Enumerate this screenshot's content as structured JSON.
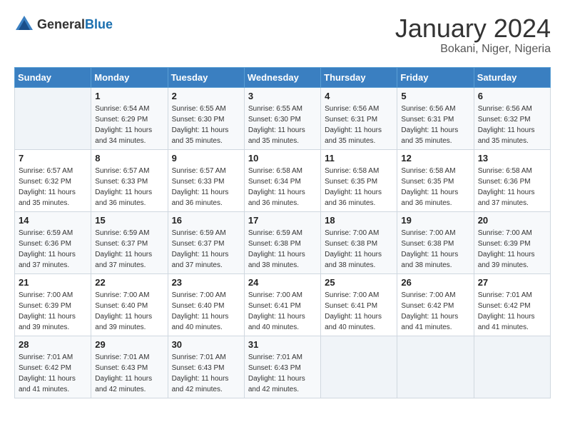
{
  "logo": {
    "general": "General",
    "blue": "Blue"
  },
  "header": {
    "title": "January 2024",
    "subtitle": "Bokani, Niger, Nigeria"
  },
  "weekdays": [
    "Sunday",
    "Monday",
    "Tuesday",
    "Wednesday",
    "Thursday",
    "Friday",
    "Saturday"
  ],
  "weeks": [
    [
      {
        "day": "",
        "sunrise": "",
        "sunset": "",
        "daylight": ""
      },
      {
        "day": "1",
        "sunrise": "Sunrise: 6:54 AM",
        "sunset": "Sunset: 6:29 PM",
        "daylight": "Daylight: 11 hours and 34 minutes."
      },
      {
        "day": "2",
        "sunrise": "Sunrise: 6:55 AM",
        "sunset": "Sunset: 6:30 PM",
        "daylight": "Daylight: 11 hours and 35 minutes."
      },
      {
        "day": "3",
        "sunrise": "Sunrise: 6:55 AM",
        "sunset": "Sunset: 6:30 PM",
        "daylight": "Daylight: 11 hours and 35 minutes."
      },
      {
        "day": "4",
        "sunrise": "Sunrise: 6:56 AM",
        "sunset": "Sunset: 6:31 PM",
        "daylight": "Daylight: 11 hours and 35 minutes."
      },
      {
        "day": "5",
        "sunrise": "Sunrise: 6:56 AM",
        "sunset": "Sunset: 6:31 PM",
        "daylight": "Daylight: 11 hours and 35 minutes."
      },
      {
        "day": "6",
        "sunrise": "Sunrise: 6:56 AM",
        "sunset": "Sunset: 6:32 PM",
        "daylight": "Daylight: 11 hours and 35 minutes."
      }
    ],
    [
      {
        "day": "7",
        "sunrise": "Sunrise: 6:57 AM",
        "sunset": "Sunset: 6:32 PM",
        "daylight": "Daylight: 11 hours and 35 minutes."
      },
      {
        "day": "8",
        "sunrise": "Sunrise: 6:57 AM",
        "sunset": "Sunset: 6:33 PM",
        "daylight": "Daylight: 11 hours and 36 minutes."
      },
      {
        "day": "9",
        "sunrise": "Sunrise: 6:57 AM",
        "sunset": "Sunset: 6:33 PM",
        "daylight": "Daylight: 11 hours and 36 minutes."
      },
      {
        "day": "10",
        "sunrise": "Sunrise: 6:58 AM",
        "sunset": "Sunset: 6:34 PM",
        "daylight": "Daylight: 11 hours and 36 minutes."
      },
      {
        "day": "11",
        "sunrise": "Sunrise: 6:58 AM",
        "sunset": "Sunset: 6:35 PM",
        "daylight": "Daylight: 11 hours and 36 minutes."
      },
      {
        "day": "12",
        "sunrise": "Sunrise: 6:58 AM",
        "sunset": "Sunset: 6:35 PM",
        "daylight": "Daylight: 11 hours and 36 minutes."
      },
      {
        "day": "13",
        "sunrise": "Sunrise: 6:58 AM",
        "sunset": "Sunset: 6:36 PM",
        "daylight": "Daylight: 11 hours and 37 minutes."
      }
    ],
    [
      {
        "day": "14",
        "sunrise": "Sunrise: 6:59 AM",
        "sunset": "Sunset: 6:36 PM",
        "daylight": "Daylight: 11 hours and 37 minutes."
      },
      {
        "day": "15",
        "sunrise": "Sunrise: 6:59 AM",
        "sunset": "Sunset: 6:37 PM",
        "daylight": "Daylight: 11 hours and 37 minutes."
      },
      {
        "day": "16",
        "sunrise": "Sunrise: 6:59 AM",
        "sunset": "Sunset: 6:37 PM",
        "daylight": "Daylight: 11 hours and 37 minutes."
      },
      {
        "day": "17",
        "sunrise": "Sunrise: 6:59 AM",
        "sunset": "Sunset: 6:38 PM",
        "daylight": "Daylight: 11 hours and 38 minutes."
      },
      {
        "day": "18",
        "sunrise": "Sunrise: 7:00 AM",
        "sunset": "Sunset: 6:38 PM",
        "daylight": "Daylight: 11 hours and 38 minutes."
      },
      {
        "day": "19",
        "sunrise": "Sunrise: 7:00 AM",
        "sunset": "Sunset: 6:38 PM",
        "daylight": "Daylight: 11 hours and 38 minutes."
      },
      {
        "day": "20",
        "sunrise": "Sunrise: 7:00 AM",
        "sunset": "Sunset: 6:39 PM",
        "daylight": "Daylight: 11 hours and 39 minutes."
      }
    ],
    [
      {
        "day": "21",
        "sunrise": "Sunrise: 7:00 AM",
        "sunset": "Sunset: 6:39 PM",
        "daylight": "Daylight: 11 hours and 39 minutes."
      },
      {
        "day": "22",
        "sunrise": "Sunrise: 7:00 AM",
        "sunset": "Sunset: 6:40 PM",
        "daylight": "Daylight: 11 hours and 39 minutes."
      },
      {
        "day": "23",
        "sunrise": "Sunrise: 7:00 AM",
        "sunset": "Sunset: 6:40 PM",
        "daylight": "Daylight: 11 hours and 40 minutes."
      },
      {
        "day": "24",
        "sunrise": "Sunrise: 7:00 AM",
        "sunset": "Sunset: 6:41 PM",
        "daylight": "Daylight: 11 hours and 40 minutes."
      },
      {
        "day": "25",
        "sunrise": "Sunrise: 7:00 AM",
        "sunset": "Sunset: 6:41 PM",
        "daylight": "Daylight: 11 hours and 40 minutes."
      },
      {
        "day": "26",
        "sunrise": "Sunrise: 7:00 AM",
        "sunset": "Sunset: 6:42 PM",
        "daylight": "Daylight: 11 hours and 41 minutes."
      },
      {
        "day": "27",
        "sunrise": "Sunrise: 7:01 AM",
        "sunset": "Sunset: 6:42 PM",
        "daylight": "Daylight: 11 hours and 41 minutes."
      }
    ],
    [
      {
        "day": "28",
        "sunrise": "Sunrise: 7:01 AM",
        "sunset": "Sunset: 6:42 PM",
        "daylight": "Daylight: 11 hours and 41 minutes."
      },
      {
        "day": "29",
        "sunrise": "Sunrise: 7:01 AM",
        "sunset": "Sunset: 6:43 PM",
        "daylight": "Daylight: 11 hours and 42 minutes."
      },
      {
        "day": "30",
        "sunrise": "Sunrise: 7:01 AM",
        "sunset": "Sunset: 6:43 PM",
        "daylight": "Daylight: 11 hours and 42 minutes."
      },
      {
        "day": "31",
        "sunrise": "Sunrise: 7:01 AM",
        "sunset": "Sunset: 6:43 PM",
        "daylight": "Daylight: 11 hours and 42 minutes."
      },
      {
        "day": "",
        "sunrise": "",
        "sunset": "",
        "daylight": ""
      },
      {
        "day": "",
        "sunrise": "",
        "sunset": "",
        "daylight": ""
      },
      {
        "day": "",
        "sunrise": "",
        "sunset": "",
        "daylight": ""
      }
    ]
  ]
}
